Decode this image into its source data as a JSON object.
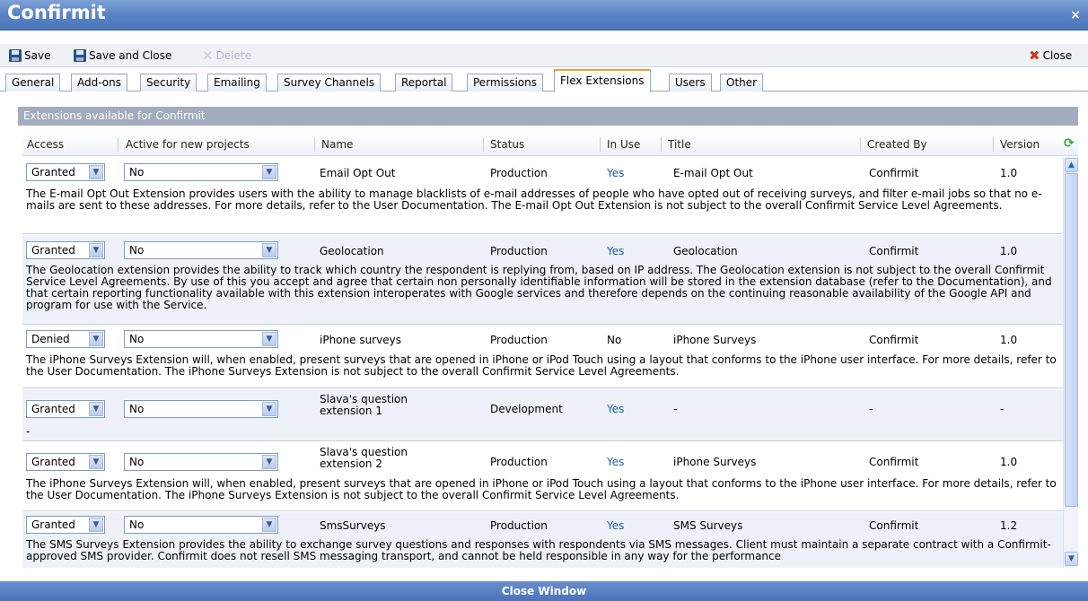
{
  "window": {
    "title": "Confirmit",
    "close_glyph": "×"
  },
  "toolbar": {
    "save": "Save",
    "save_and_close": "Save and Close",
    "delete": "Delete",
    "close": "Close"
  },
  "tabs": [
    {
      "label": "General"
    },
    {
      "label": "Add-ons"
    },
    {
      "label": "Security"
    },
    {
      "label": "Emailing"
    },
    {
      "label": "Survey Channels"
    },
    {
      "label": "Reportal"
    },
    {
      "label": "Permissions"
    },
    {
      "label": "Flex Extensions",
      "active": true
    },
    {
      "label": "Users"
    },
    {
      "label": "Other"
    }
  ],
  "panel": {
    "heading": "Extensions available for Confirmit"
  },
  "columns": {
    "access": "Access",
    "active": "Active for new projects",
    "name": "Name",
    "status": "Status",
    "in_use": "In Use",
    "title": "Title",
    "created_by": "Created By",
    "version": "Version"
  },
  "rows": [
    {
      "access": "Granted",
      "active": "No",
      "name": "Email Opt Out",
      "status": "Production",
      "in_use": "Yes",
      "title": "E-mail Opt Out",
      "created_by": "Confirmit",
      "version": "1.0",
      "description": "The E-mail Opt Out Extension provides users with the ability to manage blacklists of e-mail addresses of people who have opted out of receiving surveys, and filter e-mail jobs so that no e-mails are sent to these addresses. For more details, refer to the User Documentation. The E-mail Opt Out Extension is not subject to the overall Confirmit Service Level Agreements."
    },
    {
      "access": "Granted",
      "active": "No",
      "name": "Geolocation",
      "status": "Production",
      "in_use": "Yes",
      "title": "Geolocation",
      "created_by": "Confirmit",
      "version": "1.0",
      "description": "The Geolocation extension provides the ability to track which country the respondent is replying from, based on IP address. The Geolocation extension is not subject to the overall Confirmit Service Level Agreements. By use of this you accept and agree that certain non personally identifiable information will be stored in the extension database (refer to the Documentation), and that certain reporting functionality available with this extension interoperates with Google services and therefore depends on the continuing reasonable availability of the Google API and program for use with the Service."
    },
    {
      "access": "Denied",
      "active": "No",
      "name": "iPhone surveys",
      "status": "Production",
      "in_use": "No",
      "title": "iPhone Surveys",
      "created_by": "Confirmit",
      "version": "1.0",
      "description": "The iPhone Surveys Extension will, when enabled, present surveys that are opened in iPhone or iPod Touch using a layout that conforms to the iPhone user interface. For more details, refer to the User Documentation. The iPhone Surveys Extension is not subject to the overall Confirmit Service Level Agreements."
    },
    {
      "access": "Granted",
      "active": "No",
      "name": "Slava's question extension 1",
      "status": "Development",
      "in_use": "Yes",
      "title": "-",
      "created_by": "-",
      "version": "-",
      "description": "-"
    },
    {
      "access": "Granted",
      "active": "No",
      "name": "Slava's question extension 2",
      "status": "Production",
      "in_use": "Yes",
      "title": "iPhone Surveys",
      "created_by": "Confirmit",
      "version": "1.0",
      "description": "The iPhone Surveys Extension will, when enabled, present surveys that are opened in iPhone or iPod Touch using a layout that conforms to the iPhone user interface. For more details, refer to the User Documentation. The iPhone Surveys Extension is not subject to the overall Confirmit Service Level Agreements."
    },
    {
      "access": "Granted",
      "active": "No",
      "name": "SmsSurveys",
      "status": "Production",
      "in_use": "Yes",
      "title": "SMS Surveys",
      "created_by": "Confirmit",
      "version": "1.2",
      "description": "The SMS Surveys Extension provides the ability to exchange survey questions and responses with respondents via SMS messages. Client must maintain a separate contract with a Confirmit-approved SMS provider. Confirmit does not resell SMS messaging transport, and cannot be held responsible in any way for the performance"
    }
  ],
  "footer": {
    "label": "Close Window"
  },
  "colors": {
    "title_bar": "#5a82c4",
    "link_blue": "#1f5bb5",
    "active_tab_accent": "#f0a030"
  },
  "icons": [
    "save-icon",
    "delete-icon",
    "close-icon",
    "refresh-icon",
    "dropdown-arrow-icon",
    "scroll-up-icon",
    "scroll-down-icon"
  ]
}
